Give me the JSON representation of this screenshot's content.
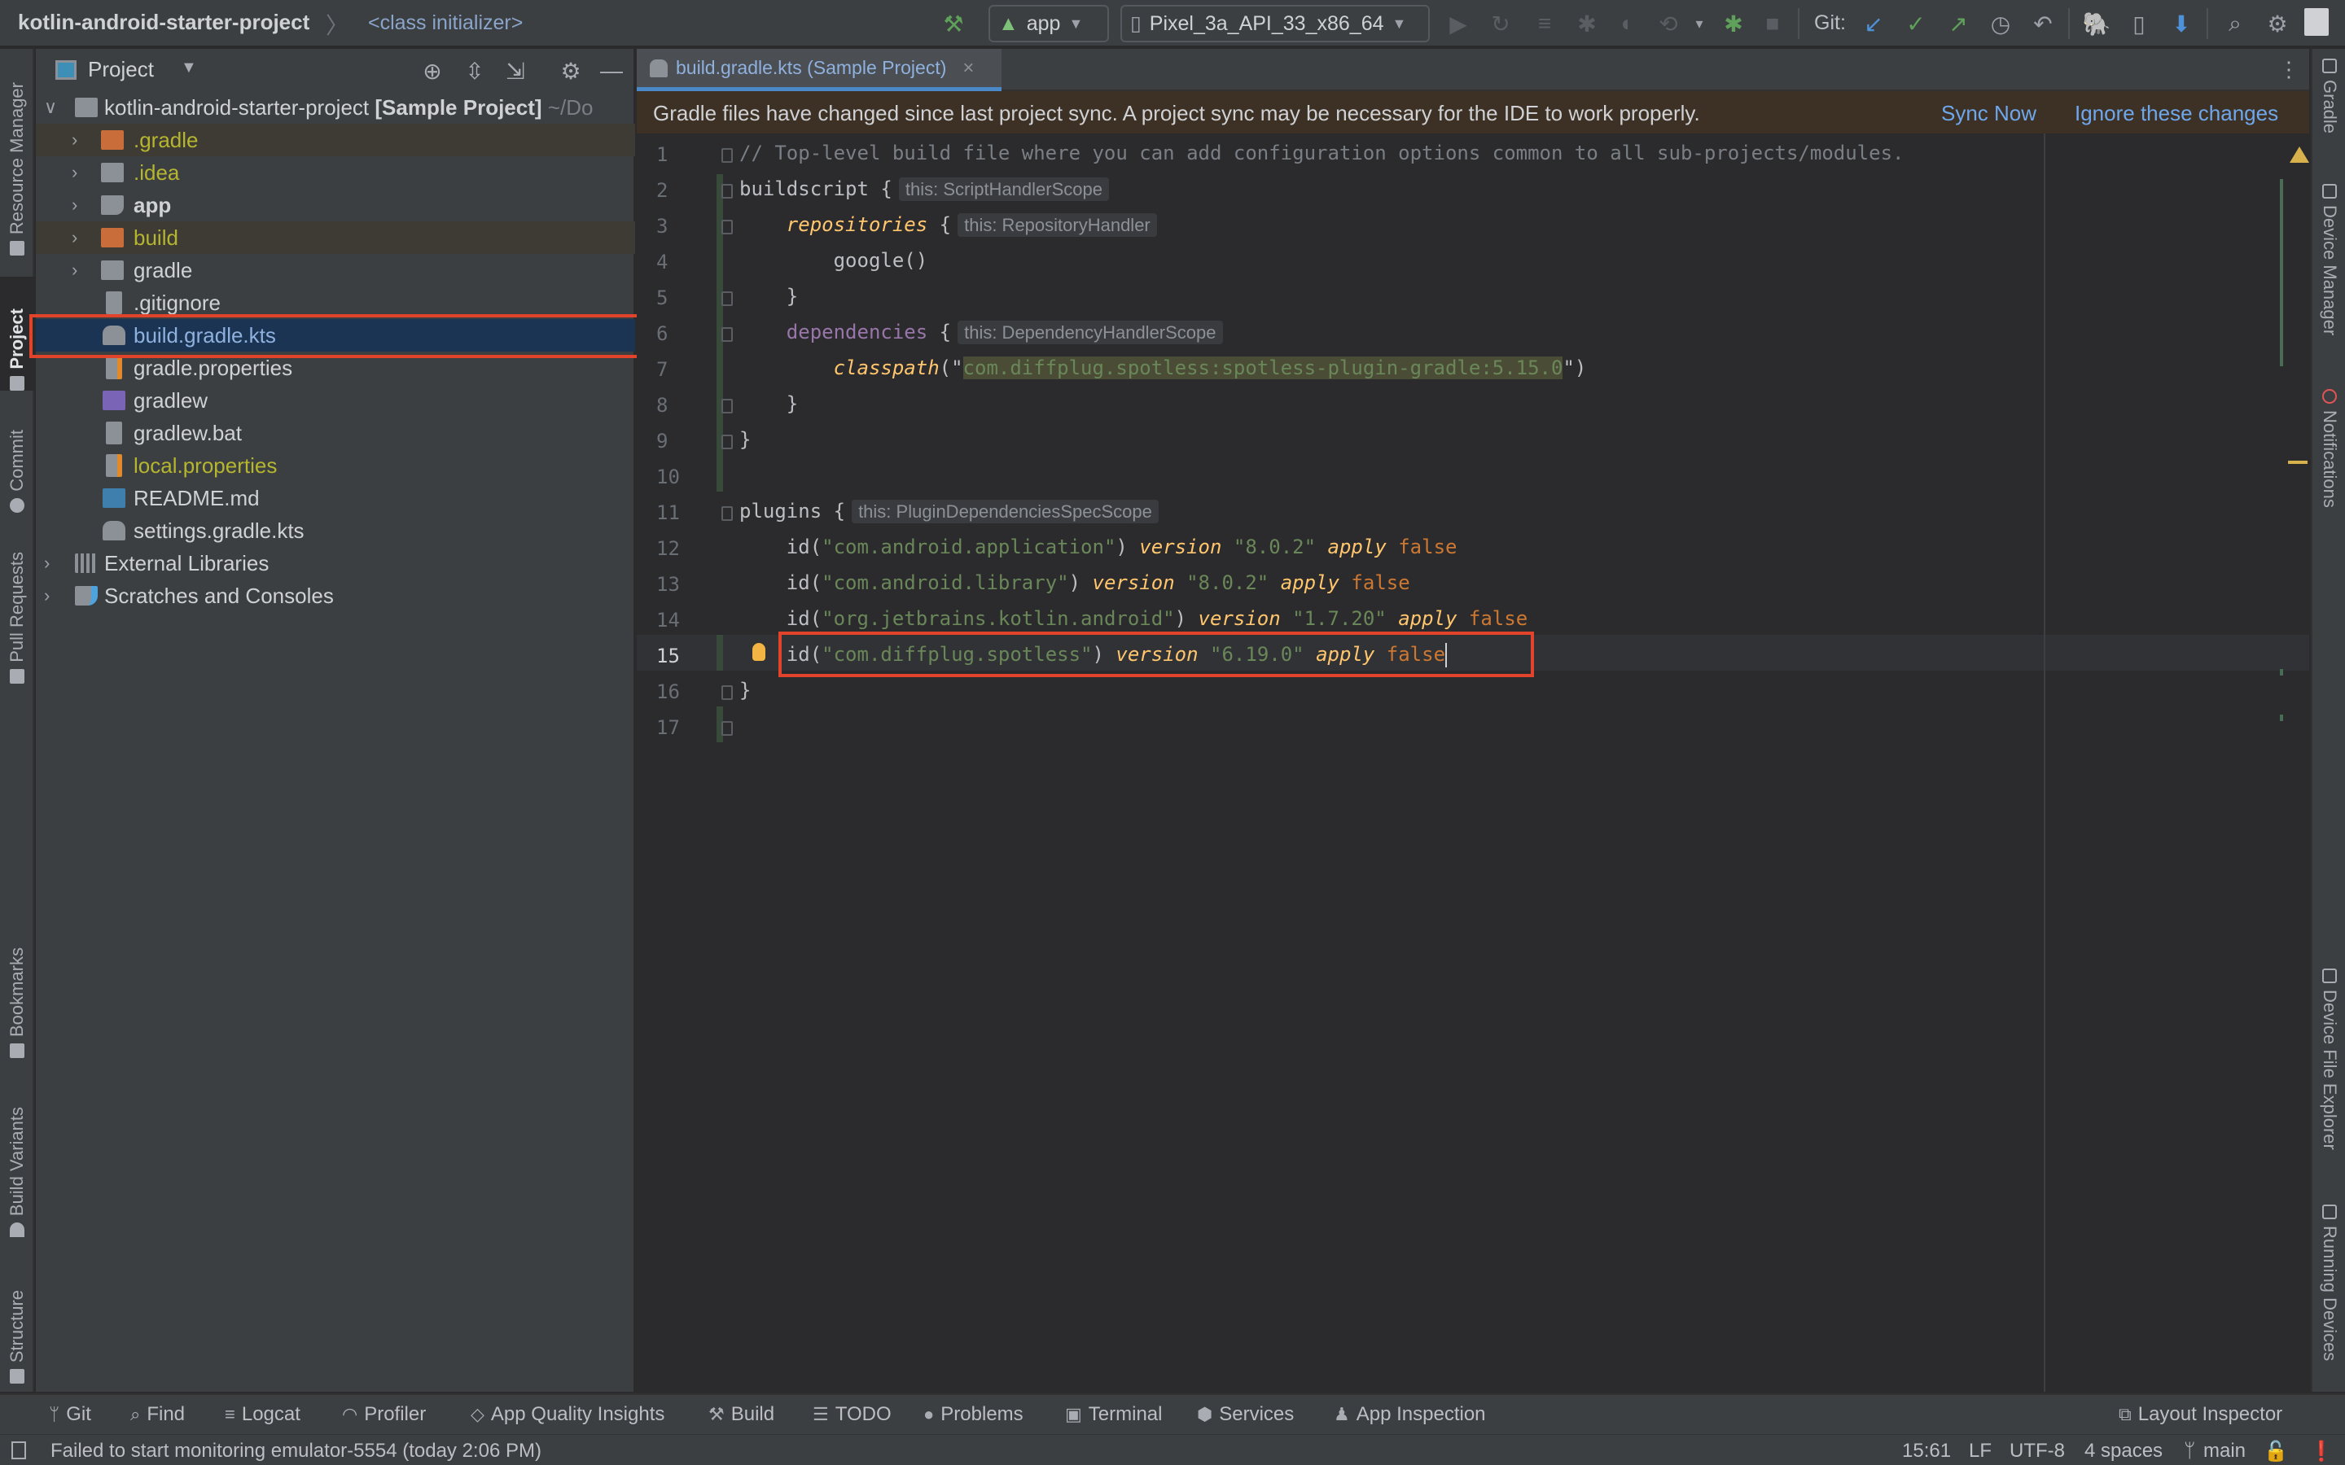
{
  "toolbar": {
    "project_name": "kotlin-android-starter-project",
    "breadcrumb_separator": "〉",
    "breadcrumb_item": "<class initializer>",
    "run_config": "app",
    "device": "Pixel_3a_API_33_x86_64",
    "git_label": "Git:",
    "icons": [
      "hammer-icon",
      "run-icon",
      "apply-changes-icon",
      "apply-code-changes-icon",
      "debug-icon",
      "profile-icon",
      "attach-debugger-icon",
      "more-actions-icon",
      "stop-icon",
      "git-update-icon",
      "git-commit-icon",
      "git-push-icon",
      "git-history-icon",
      "git-rollback-icon",
      "sync-gradle-icon",
      "device-manager-icon",
      "sdk-manager-icon",
      "search-icon",
      "settings-icon",
      "avatar-icon"
    ]
  },
  "left_stripe": {
    "tabs": [
      {
        "label": "Resource Manager",
        "icon": "resource-manager-icon"
      },
      {
        "label": "Project",
        "icon": "folder-icon",
        "active": true
      },
      {
        "label": "Commit",
        "icon": "commit-icon"
      },
      {
        "label": "Pull Requests",
        "icon": "pull-request-icon"
      },
      {
        "label": "Bookmarks",
        "icon": "bookmark-icon"
      },
      {
        "label": "Build Variants",
        "icon": "android-icon"
      },
      {
        "label": "Structure",
        "icon": "structure-icon"
      }
    ]
  },
  "right_stripe": {
    "tabs": [
      {
        "label": "Gradle",
        "icon": "gradle-icon"
      },
      {
        "label": "Device Manager",
        "icon": "device-manager-icon"
      },
      {
        "label": "Notifications",
        "icon": "bell-icon"
      },
      {
        "label": "Device File Explorer",
        "icon": "device-file-icon"
      },
      {
        "label": "Running Devices",
        "icon": "running-devices-icon"
      }
    ]
  },
  "project_panel": {
    "title": "Project",
    "root": {
      "name": "kotlin-android-starter-project",
      "tag": "[Sample Project]",
      "path": "~/Do"
    },
    "items": [
      {
        "label": ".gradle",
        "type": "folder",
        "color": "#b5b52f",
        "ignored": true,
        "expandable": true
      },
      {
        "label": ".idea",
        "type": "folder",
        "color": "#b5b52f",
        "ignored": false,
        "expandable": true
      },
      {
        "label": "app",
        "type": "module",
        "color": "#cfd1d4",
        "bold": true,
        "expandable": true
      },
      {
        "label": "build",
        "type": "folder",
        "color": "#b5b52f",
        "ignored": true,
        "expandable": true
      },
      {
        "label": "gradle",
        "type": "folder",
        "color": "#cfd1d4",
        "expandable": true
      },
      {
        "label": ".gitignore",
        "type": "file",
        "color": "#cfd1d4"
      },
      {
        "label": "build.gradle.kts",
        "type": "gradle-kts",
        "color": "#8fb1de",
        "selected": true
      },
      {
        "label": "gradle.properties",
        "type": "properties",
        "color": "#cfd1d4"
      },
      {
        "label": "gradlew",
        "type": "shell",
        "color": "#cfd1d4"
      },
      {
        "label": "gradlew.bat",
        "type": "file",
        "color": "#cfd1d4"
      },
      {
        "label": "local.properties",
        "type": "properties",
        "color": "#b5b52f"
      },
      {
        "label": "README.md",
        "type": "markdown",
        "color": "#cfd1d4"
      },
      {
        "label": "settings.gradle.kts",
        "type": "gradle-kts",
        "color": "#cfd1d4"
      }
    ],
    "extra": [
      {
        "label": "External Libraries",
        "icon": "library-icon"
      },
      {
        "label": "Scratches and Consoles",
        "icon": "scratches-icon"
      }
    ]
  },
  "editor": {
    "tab_label": "build.gradle.kts (Sample Project)",
    "notification": {
      "text": "Gradle files have changed since last project sync. A project sync may be necessary for the IDE to work properly.",
      "sync_now": "Sync Now",
      "ignore": "Ignore these changes"
    },
    "current_line": 15,
    "lines": [
      {
        "n": "1",
        "comment": "// Top-level build file where you can add configuration options common to all sub-projects/modules."
      },
      {
        "n": "2",
        "kw": "buildscript",
        "brace": " {",
        "hint": "this: ScriptHandlerScope"
      },
      {
        "n": "3",
        "indent": "    ",
        "fn": "repositories",
        "brace": " {",
        "hint": "this: RepositoryHandler"
      },
      {
        "n": "4",
        "plain": "        google()"
      },
      {
        "n": "5",
        "plain": "    }"
      },
      {
        "n": "6",
        "indent": "    ",
        "dep": "dependencies",
        "brace": " {",
        "hint": "this: DependencyHandlerScope"
      },
      {
        "n": "7",
        "indent": "        ",
        "fn": "classpath",
        "open": "(\"",
        "str": "com.diffplug.spotless:spotless-plugin-gradle:5.15.0",
        "close": "\")"
      },
      {
        "n": "8",
        "plain": "    }"
      },
      {
        "n": "9",
        "plain": "}"
      },
      {
        "n": "10",
        "plain": ""
      },
      {
        "n": "11",
        "kw": "plugins",
        "brace": " {",
        "hint": "this: PluginDependenciesSpecScope"
      },
      {
        "n": "12",
        "plugin": "com.android.application",
        "version": "8.0.2"
      },
      {
        "n": "13",
        "plugin": "com.android.library",
        "version": "8.0.2"
      },
      {
        "n": "14",
        "plugin": "org.jetbrains.kotlin.android",
        "version": "1.7.20"
      },
      {
        "n": "15",
        "plugin": "com.diffplug.spotless",
        "version": "6.19.0",
        "highlighted": true
      },
      {
        "n": "16",
        "plain": "}"
      },
      {
        "n": "17",
        "plain": ""
      }
    ],
    "tokens": {
      "id": "id",
      "version": "version",
      "apply": "apply",
      "false": "false"
    }
  },
  "bottom_tools": [
    {
      "label": "Git",
      "icon": "git-icon"
    },
    {
      "label": "Find",
      "icon": "search-icon"
    },
    {
      "label": "Logcat",
      "icon": "logcat-icon"
    },
    {
      "label": "Profiler",
      "icon": "profiler-icon"
    },
    {
      "label": "App Quality Insights",
      "icon": "diamond-icon"
    },
    {
      "label": "Build",
      "icon": "hammer-icon"
    },
    {
      "label": "TODO",
      "icon": "list-icon"
    },
    {
      "label": "Problems",
      "icon": "problems-icon"
    },
    {
      "label": "Terminal",
      "icon": "terminal-icon"
    },
    {
      "label": "Services",
      "icon": "services-icon"
    },
    {
      "label": "App Inspection",
      "icon": "app-inspection-icon"
    },
    {
      "label": "Layout Inspector",
      "icon": "layout-inspector-icon"
    }
  ],
  "status_bar": {
    "message": "Failed to start monitoring emulator-5554 (today 2:06 PM)",
    "position": "15:61",
    "line_separator": "LF",
    "encoding": "UTF-8",
    "indent": "4 spaces",
    "branch": "main"
  }
}
